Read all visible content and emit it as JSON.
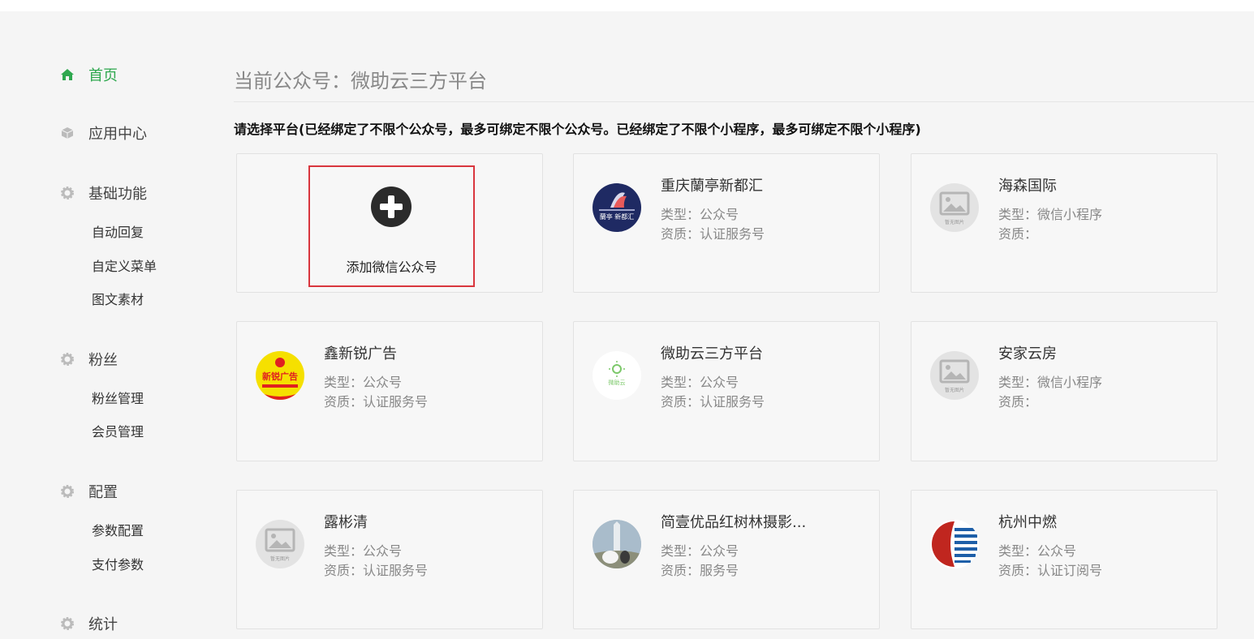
{
  "sidebar": {
    "home": "首页",
    "app_center": "应用中心",
    "basic": {
      "title": "基础功能",
      "items": [
        "自动回复",
        "自定义菜单",
        "图文素材"
      ]
    },
    "fans": {
      "title": "粉丝",
      "items": [
        "粉丝管理",
        "会员管理"
      ]
    },
    "config": {
      "title": "配置",
      "items": [
        "参数配置",
        "支付参数"
      ]
    },
    "stats": {
      "title": "统计"
    }
  },
  "main": {
    "current_title": "当前公众号：微助云三方平台",
    "notice": "请选择平台(已经绑定了不限个公众号，最多可绑定不限个公众号。已经绑定了不限个小程序，最多可绑定不限个小程序)",
    "add_label": "添加微信公众号",
    "placeholder_text": "暂无图片",
    "cards": [
      {
        "name": "重庆蘭亭新都汇",
        "type": "类型：公众号",
        "qual": "资质：认证服务号",
        "logo": "lanting-logo",
        "logo_text": "蘭亭 新都汇"
      },
      {
        "name": "海森国际",
        "type": "类型：微信小程序",
        "qual": "资质：",
        "logo": "no-image-icon"
      },
      {
        "name": "鑫新锐广告",
        "type": "类型：公众号",
        "qual": "资质：认证服务号",
        "logo": "xinrui-logo",
        "logo_text": "新锐广告"
      },
      {
        "name": "微助云三方平台",
        "type": "类型：公众号",
        "qual": "资质：认证服务号",
        "logo": "weizhuyun-logo",
        "logo_text": "微助云"
      },
      {
        "name": "安家云房",
        "type": "类型：微信小程序",
        "qual": "资质：",
        "logo": "no-image-icon"
      },
      {
        "name": "露彬清",
        "type": "类型：公众号",
        "qual": "资质：认证服务号",
        "logo": "no-image-icon"
      },
      {
        "name": "简壹优品红树林摄影...",
        "type": "类型：公众号",
        "qual": "资质：服务号",
        "logo": "wedding-photo"
      },
      {
        "name": "杭州中燃",
        "type": "类型：公众号",
        "qual": "资质：认证订阅号",
        "logo": "zhongran-logo"
      }
    ]
  },
  "colors": {
    "accent": "#2fa84f",
    "highlight_border": "#d9363e",
    "page_bg": "#f5f5f5"
  }
}
